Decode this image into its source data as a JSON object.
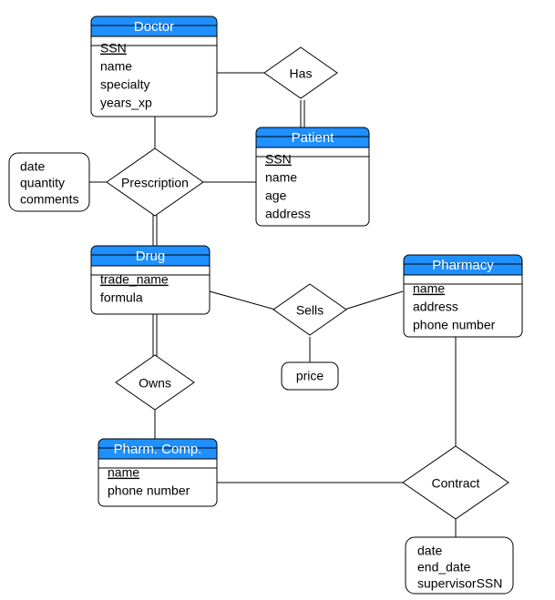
{
  "entities": {
    "doctor": {
      "title": "Doctor",
      "attrs": [
        "SSN",
        "name",
        "specialty",
        "years_xp"
      ],
      "pk": [
        0
      ]
    },
    "patient": {
      "title": "Patient",
      "attrs": [
        "SSN",
        "name",
        "age",
        "address"
      ],
      "pk": [
        0
      ]
    },
    "drug": {
      "title": "Drug",
      "attrs": [
        "trade_name",
        "formula"
      ],
      "pk": [
        0
      ]
    },
    "pharmacy": {
      "title": "Pharmacy",
      "attrs": [
        "name",
        "address",
        "phone number"
      ],
      "pk": [
        0
      ]
    },
    "pharmcomp": {
      "title": "Pharm. Comp.",
      "attrs": [
        "name",
        "phone number"
      ],
      "pk": [
        0
      ]
    }
  },
  "relationships": {
    "has": "Has",
    "prescription": "Prescription",
    "sells": "Sells",
    "owns": "Owns",
    "contract": "Contract"
  },
  "rel_attrs": {
    "prescription": [
      "date",
      "quantity",
      "comments"
    ],
    "sells": [
      "price"
    ],
    "contract": [
      "date",
      "end_date",
      "supervisorSSN"
    ]
  },
  "chart_data": {
    "type": "er-diagram",
    "entities": [
      {
        "name": "Doctor",
        "attributes": [
          "SSN",
          "name",
          "specialty",
          "years_xp"
        ],
        "key": [
          "SSN"
        ]
      },
      {
        "name": "Patient",
        "attributes": [
          "SSN",
          "name",
          "age",
          "address"
        ],
        "key": [
          "SSN"
        ]
      },
      {
        "name": "Drug",
        "attributes": [
          "trade_name",
          "formula"
        ],
        "key": [
          "trade_name"
        ]
      },
      {
        "name": "Pharmacy",
        "attributes": [
          "name",
          "address",
          "phone number"
        ],
        "key": [
          "name"
        ]
      },
      {
        "name": "Pharm. Comp.",
        "attributes": [
          "name",
          "phone number"
        ],
        "key": [
          "name"
        ]
      }
    ],
    "relationships": [
      {
        "name": "Has",
        "between": [
          "Doctor",
          "Patient"
        ],
        "attributes": []
      },
      {
        "name": "Prescription",
        "between": [
          "Doctor",
          "Patient",
          "Drug"
        ],
        "attributes": [
          "date",
          "quantity",
          "comments"
        ]
      },
      {
        "name": "Sells",
        "between": [
          "Drug",
          "Pharmacy"
        ],
        "attributes": [
          "price"
        ]
      },
      {
        "name": "Owns",
        "between": [
          "Drug",
          "Pharm. Comp."
        ],
        "attributes": []
      },
      {
        "name": "Contract",
        "between": [
          "Pharm. Comp.",
          "Pharmacy"
        ],
        "attributes": [
          "date",
          "end_date",
          "supervisorSSN"
        ]
      }
    ]
  }
}
